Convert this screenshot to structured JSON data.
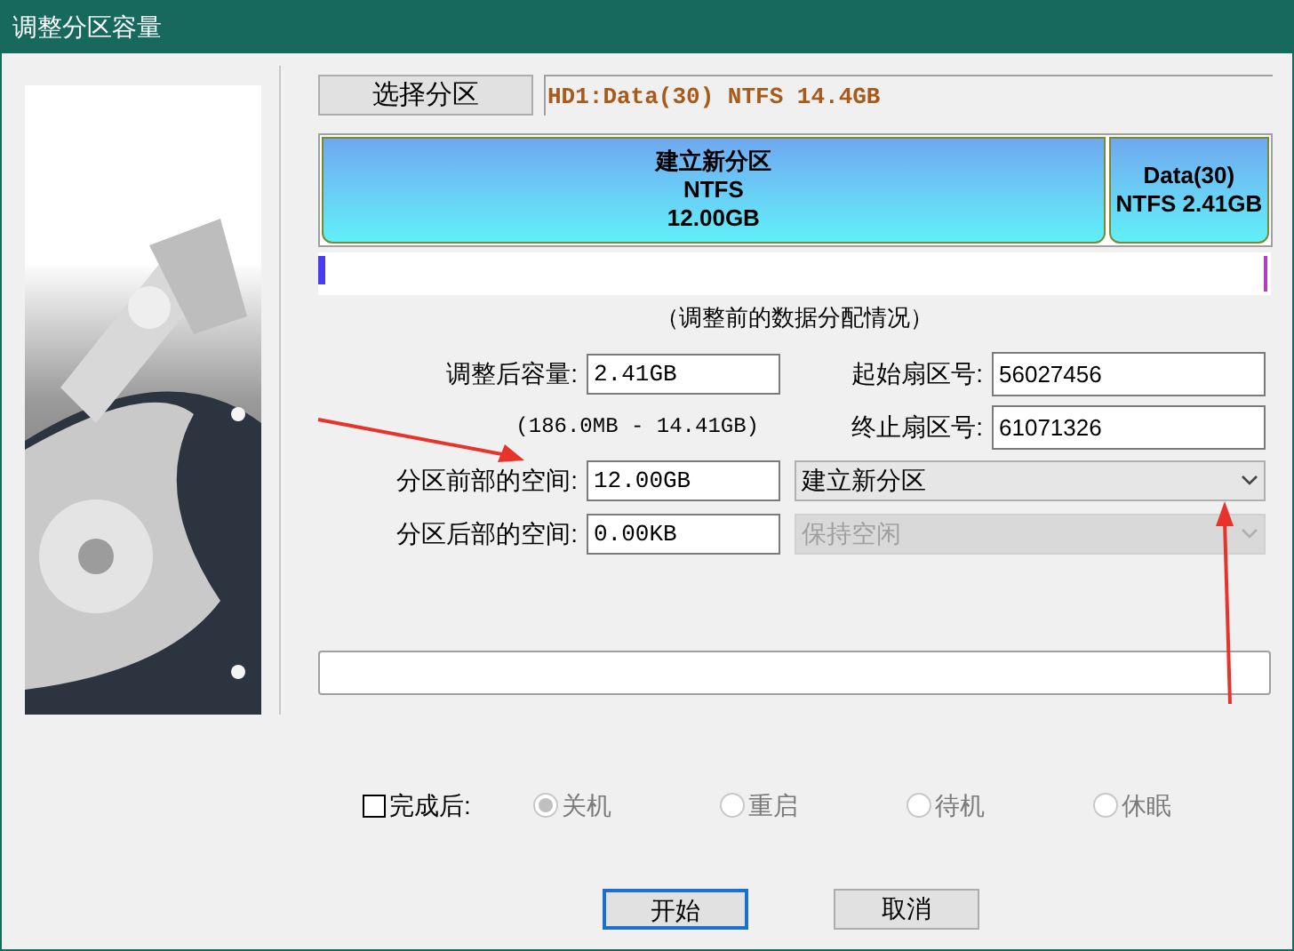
{
  "window": {
    "title": "调整分区容量"
  },
  "select_button": "选择分区",
  "partition_info": "HD1:Data(30) NTFS 14.4GB",
  "partitions": [
    {
      "lines": [
        "建立新分区",
        "NTFS",
        "12.00GB"
      ]
    },
    {
      "lines": [
        "Data(30)",
        "NTFS 2.41GB"
      ]
    }
  ],
  "map_caption": "（调整前的数据分配情况）",
  "rows": [
    {
      "label": "调整后容量:",
      "value": "2.41GB",
      "side_label": "起始扇区号:",
      "side_value": "56027456"
    },
    {
      "note": "(186.0MB - 14.41GB)",
      "side_label": "终止扇区号:",
      "side_value": "61071326"
    },
    {
      "label": "分区前部的空间:",
      "value": "12.00GB",
      "dropdown": {
        "value": "建立新分区",
        "disabled": false
      }
    },
    {
      "label": "分区后部的空间:",
      "value": "0.00KB",
      "dropdown": {
        "value": "保持空闲",
        "disabled": true
      }
    }
  ],
  "progress": {
    "level": 0
  },
  "after_done": {
    "label": "完成后:",
    "checked": false
  },
  "radios": [
    {
      "label": "关机",
      "selected": true,
      "disabled": true
    },
    {
      "label": "重启",
      "selected": false,
      "disabled": true
    },
    {
      "label": "待机",
      "selected": false,
      "disabled": true
    },
    {
      "label": "休眠",
      "selected": false,
      "disabled": true
    }
  ],
  "buttons": [
    {
      "label": "开始",
      "focused": true
    },
    {
      "label": "取消",
      "focused": false
    }
  ]
}
